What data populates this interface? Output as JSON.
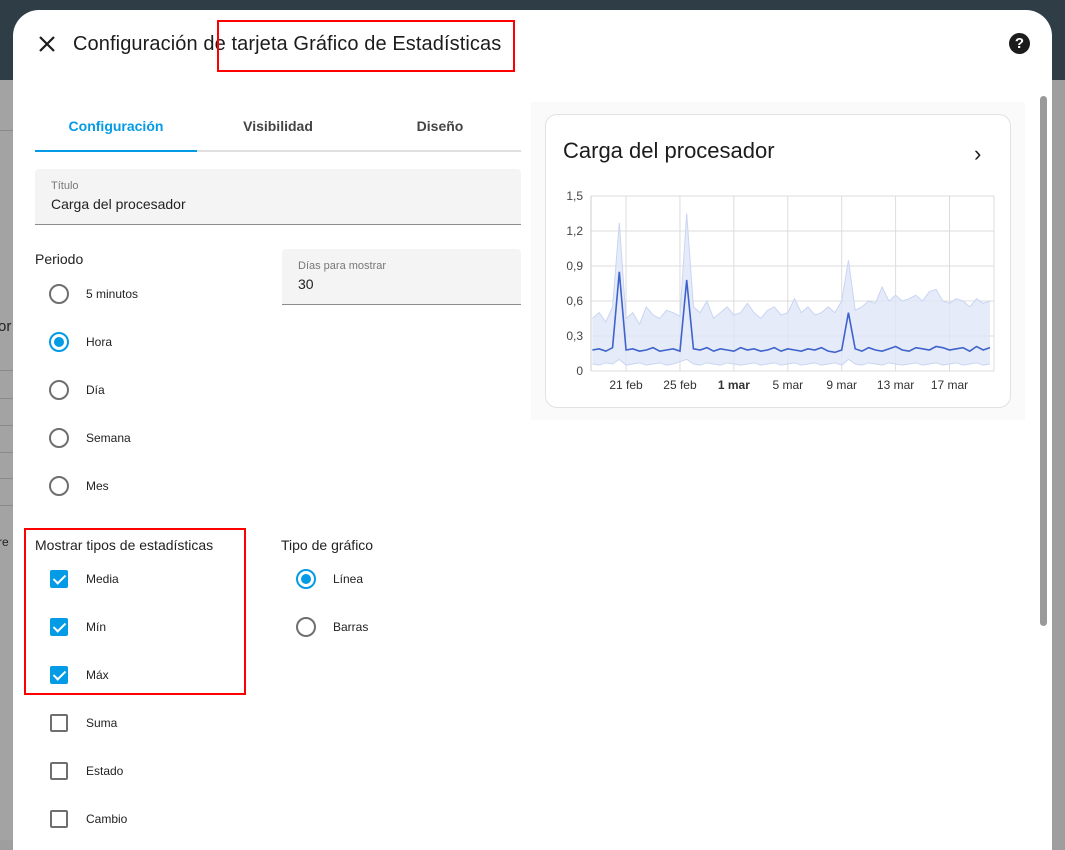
{
  "dialog": {
    "title": "Configuración de tarjeta Gráfico de Estadísticas"
  },
  "tabs": [
    {
      "label": "Configuración"
    },
    {
      "label": "Visibilidad"
    },
    {
      "label": "Diseño"
    }
  ],
  "fields": {
    "title": {
      "label": "Título",
      "value": "Carga del procesador"
    },
    "days": {
      "label": "Días para mostrar",
      "value": "30"
    }
  },
  "period": {
    "label": "Periodo",
    "options": [
      {
        "label": "5 minutos",
        "selected": false
      },
      {
        "label": "Hora",
        "selected": true
      },
      {
        "label": "Día",
        "selected": false
      },
      {
        "label": "Semana",
        "selected": false
      },
      {
        "label": "Mes",
        "selected": false
      }
    ]
  },
  "stat_types": {
    "label": "Mostrar tipos de estadísticas",
    "options": [
      {
        "label": "Media",
        "checked": true
      },
      {
        "label": "Mín",
        "checked": true
      },
      {
        "label": "Máx",
        "checked": true
      },
      {
        "label": "Suma",
        "checked": false
      },
      {
        "label": "Estado",
        "checked": false
      },
      {
        "label": "Cambio",
        "checked": false
      }
    ]
  },
  "chart_type": {
    "label": "Tipo de gráfico",
    "options": [
      {
        "label": "Línea",
        "selected": true
      },
      {
        "label": "Barras",
        "selected": false
      }
    ]
  },
  "background": {
    "text1": "or",
    "text2": "re"
  },
  "colors": {
    "accent": "#039be5",
    "series": "#3f63cc",
    "band": "#dfe6f7"
  },
  "preview": {
    "card_title": "Carga del procesador"
  },
  "chart_data": {
    "type": "line",
    "title": "Carga del procesador",
    "ylim": [
      0,
      1.5
    ],
    "yticks": [
      "0",
      "0,3",
      "0,6",
      "0,9",
      "1,2",
      "1,5"
    ],
    "xlim": [
      0.4,
      30.3
    ],
    "xticks": [
      {
        "day": 3,
        "label": "21 feb"
      },
      {
        "day": 7,
        "label": "25 feb"
      },
      {
        "day": 11,
        "label": "1 mar",
        "bold": true
      },
      {
        "day": 15,
        "label": "5 mar"
      },
      {
        "day": 19,
        "label": "9 mar"
      },
      {
        "day": 23,
        "label": "13 mar"
      },
      {
        "day": 27,
        "label": "17 mar"
      }
    ],
    "grid": true,
    "x_day_start": 0.5,
    "x_day_step": 0.5,
    "mean": [
      0.18,
      0.19,
      0.17,
      0.2,
      0.85,
      0.18,
      0.19,
      0.17,
      0.18,
      0.2,
      0.17,
      0.18,
      0.19,
      0.17,
      0.78,
      0.19,
      0.18,
      0.2,
      0.17,
      0.19,
      0.18,
      0.17,
      0.2,
      0.18,
      0.19,
      0.17,
      0.18,
      0.2,
      0.17,
      0.19,
      0.18,
      0.17,
      0.19,
      0.18,
      0.2,
      0.17,
      0.16,
      0.18,
      0.5,
      0.19,
      0.17,
      0.2,
      0.18,
      0.17,
      0.19,
      0.21,
      0.18,
      0.17,
      0.2,
      0.19,
      0.18,
      0.21,
      0.2,
      0.18,
      0.19,
      0.2,
      0.17,
      0.21,
      0.18,
      0.2
    ],
    "min": [
      0.06,
      0.05,
      0.07,
      0.06,
      0.1,
      0.05,
      0.06,
      0.07,
      0.05,
      0.06,
      0.07,
      0.05,
      0.06,
      0.08,
      0.1,
      0.06,
      0.05,
      0.07,
      0.06,
      0.05,
      0.07,
      0.06,
      0.05,
      0.06,
      0.07,
      0.05,
      0.06,
      0.07,
      0.05,
      0.06,
      0.07,
      0.05,
      0.06,
      0.07,
      0.05,
      0.06,
      0.07,
      0.05,
      0.1,
      0.06,
      0.05,
      0.07,
      0.06,
      0.05,
      0.07,
      0.06,
      0.05,
      0.06,
      0.07,
      0.05,
      0.06,
      0.07,
      0.05,
      0.06,
      0.07,
      0.05,
      0.06,
      0.07,
      0.05,
      0.06
    ],
    "max": [
      0.45,
      0.5,
      0.42,
      0.55,
      1.27,
      0.45,
      0.5,
      0.4,
      0.55,
      0.48,
      0.45,
      0.52,
      0.5,
      0.47,
      1.35,
      0.55,
      0.5,
      0.6,
      0.45,
      0.5,
      0.55,
      0.48,
      0.5,
      0.58,
      0.5,
      0.45,
      0.52,
      0.55,
      0.48,
      0.5,
      0.62,
      0.5,
      0.55,
      0.48,
      0.5,
      0.55,
      0.5,
      0.6,
      0.95,
      0.52,
      0.55,
      0.6,
      0.58,
      0.72,
      0.6,
      0.65,
      0.6,
      0.62,
      0.65,
      0.6,
      0.68,
      0.7,
      0.6,
      0.58,
      0.62,
      0.6,
      0.55,
      0.62,
      0.58,
      0.6
    ]
  }
}
